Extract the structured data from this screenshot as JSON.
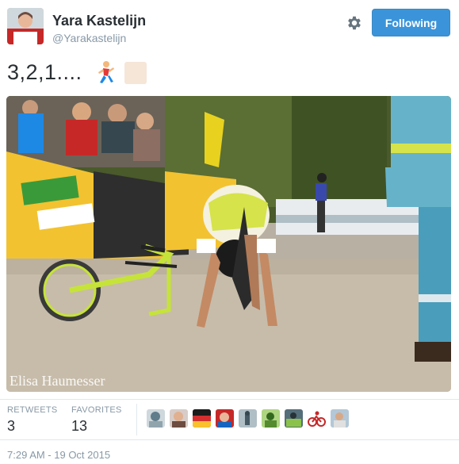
{
  "user": {
    "name": "Yara Kastelijn",
    "handle": "@Yarakastelijn",
    "avatar_icon": "profile-photo"
  },
  "actions": {
    "settings_icon": "gear-icon",
    "follow_label": "Following"
  },
  "tweet": {
    "text": "3,2,1....",
    "emoji": [
      "runner-emoji",
      "skin-tone-modifier"
    ],
    "photo_icon": "cyclist-crawling-photo",
    "photo_watermark": "Elisa Haumesser"
  },
  "stats": {
    "retweets_label": "RETWEETS",
    "retweets_value": "3",
    "favorites_label": "FAVORITES",
    "favorites_value": "13"
  },
  "favoriters": [
    "avatar-1",
    "avatar-2",
    "avatar-3",
    "avatar-4",
    "avatar-5",
    "avatar-6",
    "avatar-7",
    "avatar-8",
    "avatar-9"
  ],
  "footer": {
    "timestamp": "7:29 AM - 19 Oct 2015"
  },
  "colors": {
    "brand_blue": "#3b94d9",
    "text": "#292f33",
    "muted": "#8899a6",
    "divider": "#e1e8ed"
  }
}
